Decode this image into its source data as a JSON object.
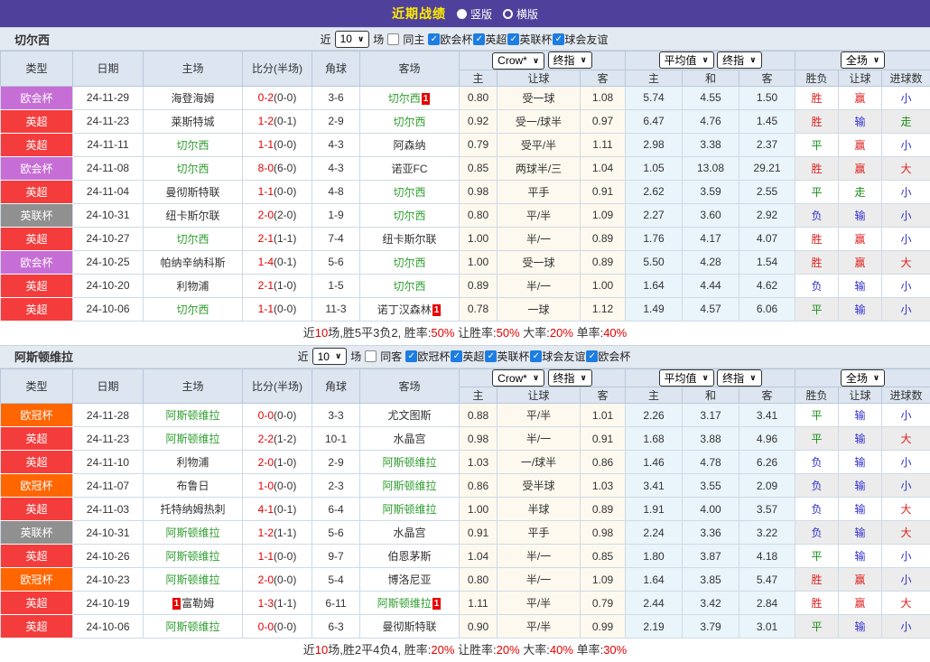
{
  "topbar": {
    "title": "近期战绩",
    "layout_options": [
      {
        "label": "竖版",
        "selected": true
      },
      {
        "label": "横版",
        "selected": false
      }
    ]
  },
  "labels": {
    "near": "近",
    "matches": "场"
  },
  "headers": {
    "main": [
      "类型",
      "日期",
      "主场",
      "比分(半场)",
      "角球",
      "客场"
    ],
    "dropdowns": [
      "Crow*",
      "终指",
      "平均值",
      "终指",
      "全场"
    ],
    "sub": [
      "主",
      "让球",
      "客",
      "主",
      "和",
      "客",
      "胜负",
      "让球",
      "进球数"
    ]
  },
  "type_colors": {
    "欧会杯": "#c76ed6",
    "英超": "#f43c3c",
    "英联杯": "#909090",
    "欧冠杯": "#ff6600"
  },
  "result_colors": {
    "胜": "#dd2222",
    "平": "#1a8c1a",
    "负": "#3030cc",
    "赢": "#dd2222",
    "输": "#3030cc",
    "走": "#1a8c1a",
    "大": "#dd2222",
    "小": "#3030cc"
  },
  "sections": [
    {
      "team": "切尔西",
      "filter": {
        "count": "10",
        "same_label": "同主",
        "same_checked": false,
        "leagues": [
          {
            "label": "欧会杯",
            "checked": true
          },
          {
            "label": "英超",
            "checked": true
          },
          {
            "label": "英联杯",
            "checked": true
          },
          {
            "label": "球会友谊",
            "checked": true
          }
        ]
      },
      "rows": [
        {
          "type": "欧会杯",
          "date": "24-11-29",
          "home": {
            "name": "海登海姆"
          },
          "score": "0-2",
          "half": "(0-0)",
          "corner": "3-6",
          "away": {
            "name": "切尔西",
            "green": true,
            "badge": "1"
          },
          "odds": [
            "0.80",
            "受一球",
            "1.08"
          ],
          "avg": [
            "5.74",
            "4.55",
            "1.50"
          ],
          "results": [
            "胜",
            "赢",
            "小"
          ]
        },
        {
          "type": "英超",
          "date": "24-11-23",
          "home": {
            "name": "莱斯特城"
          },
          "score": "1-2",
          "half": "(0-1)",
          "corner": "2-9",
          "away": {
            "name": "切尔西",
            "green": true
          },
          "odds": [
            "0.92",
            "受一/球半",
            "0.97"
          ],
          "avg": [
            "6.47",
            "4.76",
            "1.45"
          ],
          "results": [
            "胜",
            "输",
            "走"
          ]
        },
        {
          "type": "英超",
          "date": "24-11-11",
          "home": {
            "name": "切尔西",
            "green": true
          },
          "score": "1-1",
          "half": "(0-0)",
          "corner": "4-3",
          "away": {
            "name": "阿森纳"
          },
          "odds": [
            "0.79",
            "受平/半",
            "1.11"
          ],
          "avg": [
            "2.98",
            "3.38",
            "2.37"
          ],
          "results": [
            "平",
            "赢",
            "小"
          ]
        },
        {
          "type": "欧会杯",
          "date": "24-11-08",
          "home": {
            "name": "切尔西",
            "green": true
          },
          "score": "8-0",
          "half": "(6-0)",
          "corner": "4-3",
          "away": {
            "name": "诺亚FC"
          },
          "odds": [
            "0.85",
            "两球半/三",
            "1.04"
          ],
          "avg": [
            "1.05",
            "13.08",
            "29.21"
          ],
          "results": [
            "胜",
            "赢",
            "大"
          ]
        },
        {
          "type": "英超",
          "date": "24-11-04",
          "home": {
            "name": "曼彻斯特联"
          },
          "score": "1-1",
          "half": "(0-0)",
          "corner": "4-8",
          "away": {
            "name": "切尔西",
            "green": true
          },
          "odds": [
            "0.98",
            "平手",
            "0.91"
          ],
          "avg": [
            "2.62",
            "3.59",
            "2.55"
          ],
          "results": [
            "平",
            "走",
            "小"
          ]
        },
        {
          "type": "英联杯",
          "date": "24-10-31",
          "home": {
            "name": "纽卡斯尔联"
          },
          "score": "2-0",
          "half": "(2-0)",
          "corner": "1-9",
          "away": {
            "name": "切尔西",
            "green": true
          },
          "odds": [
            "0.80",
            "平/半",
            "1.09"
          ],
          "avg": [
            "2.27",
            "3.60",
            "2.92"
          ],
          "results": [
            "负",
            "输",
            "小"
          ]
        },
        {
          "type": "英超",
          "date": "24-10-27",
          "home": {
            "name": "切尔西",
            "green": true
          },
          "score": "2-1",
          "half": "(1-1)",
          "corner": "7-4",
          "away": {
            "name": "纽卡斯尔联"
          },
          "odds": [
            "1.00",
            "半/一",
            "0.89"
          ],
          "avg": [
            "1.76",
            "4.17",
            "4.07"
          ],
          "results": [
            "胜",
            "赢",
            "小"
          ]
        },
        {
          "type": "欧会杯",
          "date": "24-10-25",
          "home": {
            "name": "帕纳辛纳科斯"
          },
          "score": "1-4",
          "half": "(0-1)",
          "corner": "5-6",
          "away": {
            "name": "切尔西",
            "green": true
          },
          "odds": [
            "1.00",
            "受一球",
            "0.89"
          ],
          "avg": [
            "5.50",
            "4.28",
            "1.54"
          ],
          "results": [
            "胜",
            "赢",
            "大"
          ]
        },
        {
          "type": "英超",
          "date": "24-10-20",
          "home": {
            "name": "利物浦"
          },
          "score": "2-1",
          "half": "(1-0)",
          "corner": "1-5",
          "away": {
            "name": "切尔西",
            "green": true
          },
          "odds": [
            "0.89",
            "半/一",
            "1.00"
          ],
          "avg": [
            "1.64",
            "4.44",
            "4.62"
          ],
          "results": [
            "负",
            "输",
            "小"
          ]
        },
        {
          "type": "英超",
          "date": "24-10-06",
          "home": {
            "name": "切尔西",
            "green": true
          },
          "score": "1-1",
          "half": "(0-0)",
          "corner": "11-3",
          "away": {
            "name": "诺丁汉森林",
            "badge": "1"
          },
          "odds": [
            "0.78",
            "一球",
            "1.12"
          ],
          "avg": [
            "1.49",
            "4.57",
            "6.06"
          ],
          "results": [
            "平",
            "输",
            "小"
          ]
        }
      ],
      "summary": [
        {
          "t": "近"
        },
        {
          "t": "10",
          "red": true
        },
        {
          "t": "场,胜5平3负2, 胜率:"
        },
        {
          "t": "50%",
          "red": true
        },
        {
          "t": " 让胜率:"
        },
        {
          "t": "50%",
          "red": true
        },
        {
          "t": " 大率:"
        },
        {
          "t": "20%",
          "red": true
        },
        {
          "t": " 单率:"
        },
        {
          "t": "40%",
          "red": true
        }
      ]
    },
    {
      "team": "阿斯顿维拉",
      "filter": {
        "count": "10",
        "same_label": "同客",
        "same_checked": false,
        "leagues": [
          {
            "label": "欧冠杯",
            "checked": true
          },
          {
            "label": "英超",
            "checked": true
          },
          {
            "label": "英联杯",
            "checked": true
          },
          {
            "label": "球会友谊",
            "checked": true
          },
          {
            "label": "欧会杯",
            "checked": true
          }
        ]
      },
      "rows": [
        {
          "type": "欧冠杯",
          "date": "24-11-28",
          "home": {
            "name": "阿斯顿维拉",
            "green": true
          },
          "score": "0-0",
          "half": "(0-0)",
          "corner": "3-3",
          "away": {
            "name": "尤文图斯"
          },
          "odds": [
            "0.88",
            "平/半",
            "1.01"
          ],
          "avg": [
            "2.26",
            "3.17",
            "3.41"
          ],
          "results": [
            "平",
            "输",
            "小"
          ]
        },
        {
          "type": "英超",
          "date": "24-11-23",
          "home": {
            "name": "阿斯顿维拉",
            "green": true
          },
          "score": "2-2",
          "half": "(1-2)",
          "corner": "10-1",
          "away": {
            "name": "水晶宫"
          },
          "odds": [
            "0.98",
            "半/一",
            "0.91"
          ],
          "avg": [
            "1.68",
            "3.88",
            "4.96"
          ],
          "results": [
            "平",
            "输",
            "大"
          ]
        },
        {
          "type": "英超",
          "date": "24-11-10",
          "home": {
            "name": "利物浦"
          },
          "score": "2-0",
          "half": "(1-0)",
          "corner": "2-9",
          "away": {
            "name": "阿斯顿维拉",
            "green": true
          },
          "odds": [
            "1.03",
            "一/球半",
            "0.86"
          ],
          "avg": [
            "1.46",
            "4.78",
            "6.26"
          ],
          "results": [
            "负",
            "输",
            "小"
          ]
        },
        {
          "type": "欧冠杯",
          "date": "24-11-07",
          "home": {
            "name": "布鲁日"
          },
          "score": "1-0",
          "half": "(0-0)",
          "corner": "2-3",
          "away": {
            "name": "阿斯顿维拉",
            "green": true
          },
          "odds": [
            "0.86",
            "受半球",
            "1.03"
          ],
          "avg": [
            "3.41",
            "3.55",
            "2.09"
          ],
          "results": [
            "负",
            "输",
            "小"
          ]
        },
        {
          "type": "英超",
          "date": "24-11-03",
          "home": {
            "name": "托特纳姆热刺"
          },
          "score": "4-1",
          "half": "(0-1)",
          "corner": "6-4",
          "away": {
            "name": "阿斯顿维拉",
            "green": true
          },
          "odds": [
            "1.00",
            "半球",
            "0.89"
          ],
          "avg": [
            "1.91",
            "4.00",
            "3.57"
          ],
          "results": [
            "负",
            "输",
            "大"
          ]
        },
        {
          "type": "英联杯",
          "date": "24-10-31",
          "home": {
            "name": "阿斯顿维拉",
            "green": true
          },
          "score": "1-2",
          "half": "(1-1)",
          "corner": "5-6",
          "away": {
            "name": "水晶宫"
          },
          "odds": [
            "0.91",
            "平手",
            "0.98"
          ],
          "avg": [
            "2.24",
            "3.36",
            "3.22"
          ],
          "results": [
            "负",
            "输",
            "大"
          ]
        },
        {
          "type": "英超",
          "date": "24-10-26",
          "home": {
            "name": "阿斯顿维拉",
            "green": true
          },
          "score": "1-1",
          "half": "(0-0)",
          "corner": "9-7",
          "away": {
            "name": "伯恩茅斯"
          },
          "odds": [
            "1.04",
            "半/一",
            "0.85"
          ],
          "avg": [
            "1.80",
            "3.87",
            "4.18"
          ],
          "results": [
            "平",
            "输",
            "小"
          ]
        },
        {
          "type": "欧冠杯",
          "date": "24-10-23",
          "home": {
            "name": "阿斯顿维拉",
            "green": true
          },
          "score": "2-0",
          "half": "(0-0)",
          "corner": "5-4",
          "away": {
            "name": "博洛尼亚"
          },
          "odds": [
            "0.80",
            "半/一",
            "1.09"
          ],
          "avg": [
            "1.64",
            "3.85",
            "5.47"
          ],
          "results": [
            "胜",
            "赢",
            "小"
          ]
        },
        {
          "type": "英超",
          "date": "24-10-19",
          "home": {
            "name": "富勒姆",
            "badge": "1",
            "badge_pos": "before"
          },
          "score": "1-3",
          "half": "(1-1)",
          "corner": "6-11",
          "away": {
            "name": "阿斯顿维拉",
            "green": true,
            "badge": "1"
          },
          "odds": [
            "1.11",
            "平/半",
            "0.79"
          ],
          "avg": [
            "2.44",
            "3.42",
            "2.84"
          ],
          "results": [
            "胜",
            "赢",
            "大"
          ]
        },
        {
          "type": "英超",
          "date": "24-10-06",
          "home": {
            "name": "阿斯顿维拉",
            "green": true
          },
          "score": "0-0",
          "half": "(0-0)",
          "corner": "6-3",
          "away": {
            "name": "曼彻斯特联"
          },
          "odds": [
            "0.90",
            "平/半",
            "0.99"
          ],
          "avg": [
            "2.19",
            "3.79",
            "3.01"
          ],
          "results": [
            "平",
            "输",
            "小"
          ]
        }
      ],
      "summary": [
        {
          "t": "近"
        },
        {
          "t": "10",
          "red": true
        },
        {
          "t": "场,胜2平4负4, 胜率:"
        },
        {
          "t": "20%",
          "red": true
        },
        {
          "t": " 让胜率:"
        },
        {
          "t": "20%",
          "red": true
        },
        {
          "t": " 大率:"
        },
        {
          "t": "40%",
          "red": true
        },
        {
          "t": " 单率:"
        },
        {
          "t": "30%",
          "red": true
        }
      ]
    }
  ]
}
